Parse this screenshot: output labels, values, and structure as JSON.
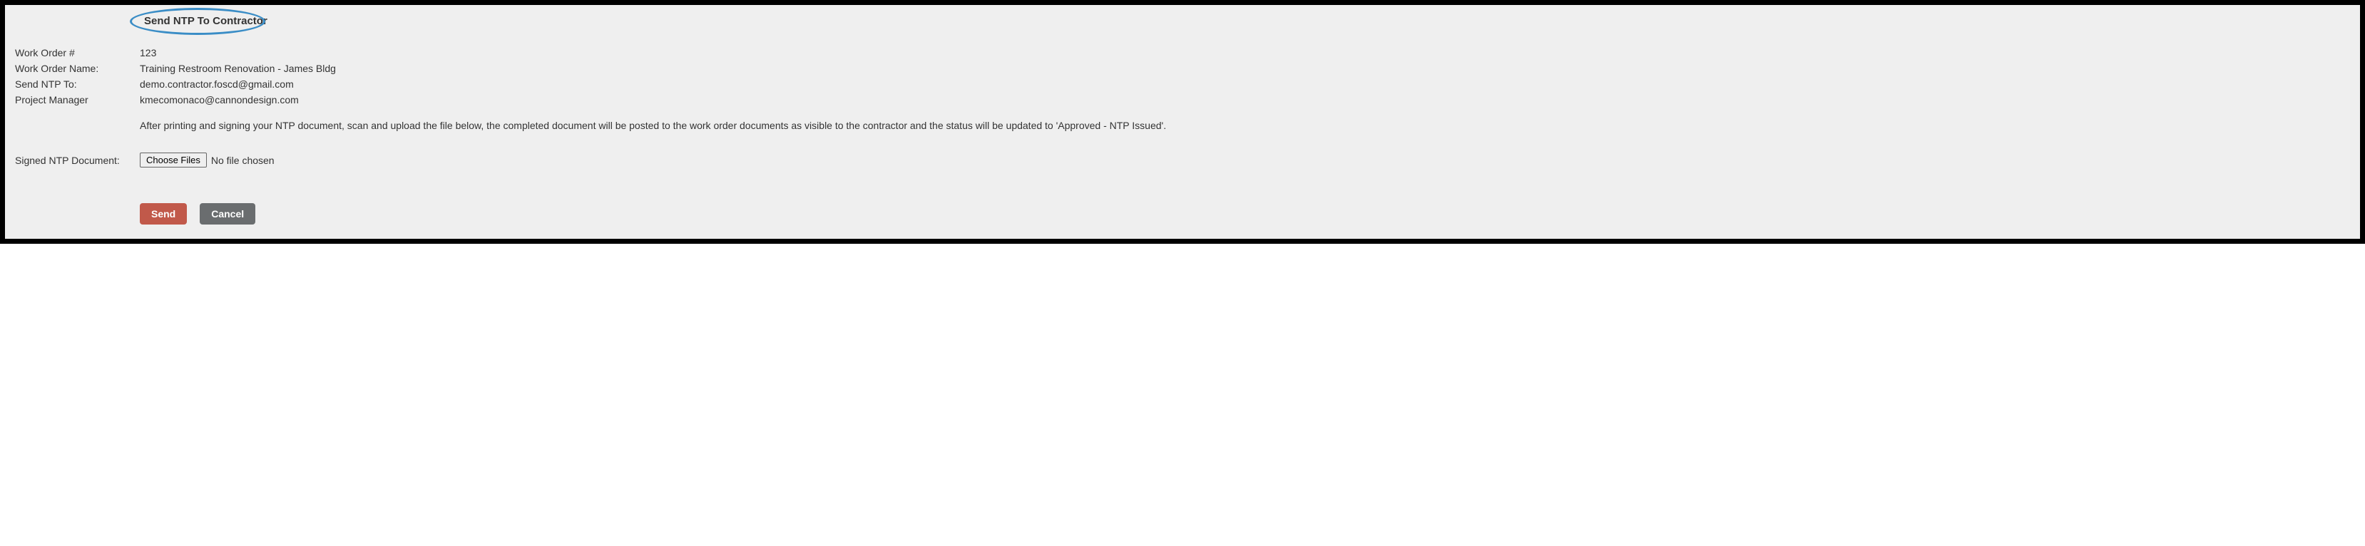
{
  "title": "Send NTP To Contractor",
  "fields": {
    "work_order_num_label": "Work Order #",
    "work_order_num_value": "123",
    "work_order_name_label": "Work Order Name:",
    "work_order_name_value": "Training Restroom Renovation - James Bldg",
    "send_ntp_to_label": "Send NTP To:",
    "send_ntp_to_value": "demo.contractor.foscd@gmail.com",
    "project_manager_label": "Project Manager",
    "project_manager_value": "kmecomonaco@cannondesign.com"
  },
  "instructions_text": "After printing and signing your NTP document, scan and upload the file below, the completed document will be posted to the work order documents as visible to the contractor and the status will be updated to 'Approved - NTP Issued'.",
  "upload": {
    "label": "Signed NTP Document:",
    "button_label": "Choose Files",
    "status_text": "No file chosen"
  },
  "buttons": {
    "send": "Send",
    "cancel": "Cancel"
  }
}
